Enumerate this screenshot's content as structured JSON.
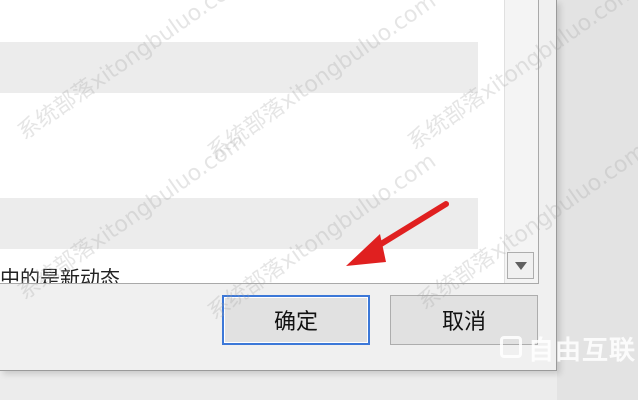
{
  "list": {
    "partial_text": "中的是新动态"
  },
  "buttons": {
    "ok_label": "确定",
    "cancel_label": "取消"
  },
  "watermark": {
    "text": "系统部落xitongbuluo.com"
  },
  "brand": {
    "text": "自由互联"
  },
  "colors": {
    "arrow": "#e02020",
    "primary_border": "#3c78d8",
    "row_shade": "#ececec"
  },
  "icons": {
    "scroll_down": "triangle-down",
    "annotation": "red-arrow"
  }
}
